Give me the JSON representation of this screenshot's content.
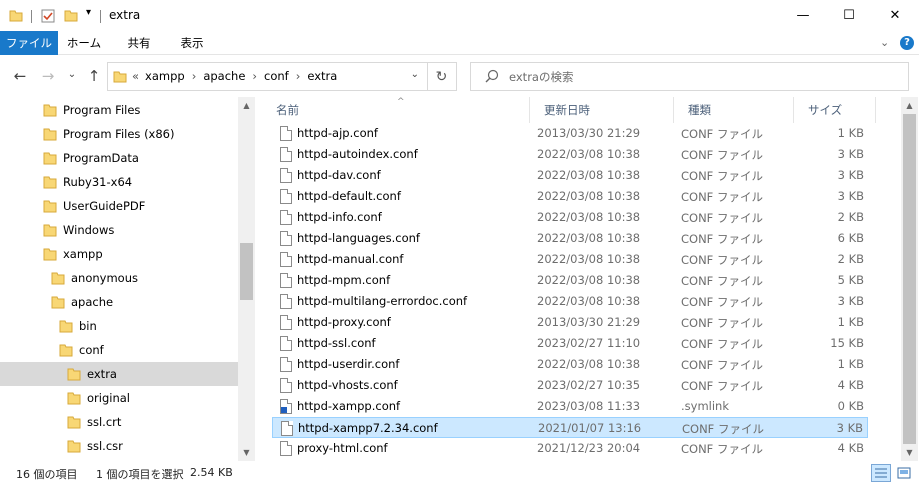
{
  "window": {
    "title": "extra",
    "minimize": "—",
    "maximize": "☐",
    "close": "✕"
  },
  "ribbon": {
    "tabs": [
      "ファイル",
      "ホーム",
      "共有",
      "表示"
    ],
    "help": "?",
    "collapse": "⌄"
  },
  "nav": {
    "back": "←",
    "forward": "→",
    "recent": "⌄",
    "up": "↑",
    "overflow": "«",
    "crumbs": [
      "xampp",
      "apache",
      "conf",
      "extra"
    ],
    "crumb_sep": "›",
    "dropdown": "⌄",
    "refresh": "↻",
    "search_placeholder": "extraの検索"
  },
  "sidebar": {
    "items": [
      {
        "label": "Program Files",
        "indent": 0,
        "icon": "folder-icon"
      },
      {
        "label": "Program Files (x86)",
        "indent": 0,
        "icon": "folder-icon"
      },
      {
        "label": "ProgramData",
        "indent": 0,
        "icon": "folder-icon"
      },
      {
        "label": "Ruby31-x64",
        "indent": 0,
        "icon": "folder-icon"
      },
      {
        "label": "UserGuidePDF",
        "indent": 0,
        "icon": "folder-icon"
      },
      {
        "label": "Windows",
        "indent": 0,
        "icon": "folder-icon"
      },
      {
        "label": "xampp",
        "indent": 0,
        "icon": "folder-icon"
      },
      {
        "label": "anonymous",
        "indent": 1,
        "icon": "folder-icon"
      },
      {
        "label": "apache",
        "indent": 1,
        "icon": "folder-icon"
      },
      {
        "label": "bin",
        "indent": 2,
        "icon": "folder-icon"
      },
      {
        "label": "conf",
        "indent": 2,
        "icon": "folder-icon"
      },
      {
        "label": "extra",
        "indent": 3,
        "icon": "folder-icon",
        "selected": true
      },
      {
        "label": "original",
        "indent": 3,
        "icon": "folder-icon"
      },
      {
        "label": "ssl.crt",
        "indent": 3,
        "icon": "folder-icon"
      },
      {
        "label": "ssl.csr",
        "indent": 3,
        "icon": "folder-icon"
      }
    ]
  },
  "columns": {
    "name": "名前",
    "date": "更新日時",
    "type": "種類",
    "size": "サイズ",
    "sort_arrow": "^"
  },
  "files": [
    {
      "name": "httpd-ajp.conf",
      "date": "2013/03/30 21:29",
      "type": "CONF ファイル",
      "size": "1 KB"
    },
    {
      "name": "httpd-autoindex.conf",
      "date": "2022/03/08 10:38",
      "type": "CONF ファイル",
      "size": "3 KB"
    },
    {
      "name": "httpd-dav.conf",
      "date": "2022/03/08 10:38",
      "type": "CONF ファイル",
      "size": "3 KB"
    },
    {
      "name": "httpd-default.conf",
      "date": "2022/03/08 10:38",
      "type": "CONF ファイル",
      "size": "3 KB"
    },
    {
      "name": "httpd-info.conf",
      "date": "2022/03/08 10:38",
      "type": "CONF ファイル",
      "size": "2 KB"
    },
    {
      "name": "httpd-languages.conf",
      "date": "2022/03/08 10:38",
      "type": "CONF ファイル",
      "size": "6 KB"
    },
    {
      "name": "httpd-manual.conf",
      "date": "2022/03/08 10:38",
      "type": "CONF ファイル",
      "size": "2 KB"
    },
    {
      "name": "httpd-mpm.conf",
      "date": "2022/03/08 10:38",
      "type": "CONF ファイル",
      "size": "5 KB"
    },
    {
      "name": "httpd-multilang-errordoc.conf",
      "date": "2022/03/08 10:38",
      "type": "CONF ファイル",
      "size": "3 KB"
    },
    {
      "name": "httpd-proxy.conf",
      "date": "2013/03/30 21:29",
      "type": "CONF ファイル",
      "size": "1 KB"
    },
    {
      "name": "httpd-ssl.conf",
      "date": "2023/02/27 11:10",
      "type": "CONF ファイル",
      "size": "15 KB"
    },
    {
      "name": "httpd-userdir.conf",
      "date": "2022/03/08 10:38",
      "type": "CONF ファイル",
      "size": "1 KB"
    },
    {
      "name": "httpd-vhosts.conf",
      "date": "2023/02/27 10:35",
      "type": "CONF ファイル",
      "size": "4 KB"
    },
    {
      "name": "httpd-xampp.conf",
      "date": "2023/03/08 11:33",
      "type": ".symlink",
      "size": "0 KB",
      "symlink": true
    },
    {
      "name": "httpd-xampp7.2.34.conf",
      "date": "2021/01/07 13:16",
      "type": "CONF ファイル",
      "size": "3 KB",
      "selected": true
    },
    {
      "name": "proxy-html.conf",
      "date": "2021/12/23 20:04",
      "type": "CONF ファイル",
      "size": "4 KB"
    }
  ],
  "status": {
    "count": "16 個の項目",
    "selection": "1 個の項目を選択",
    "selection_size": "2.54 KB"
  },
  "colors": {
    "accent": "#1979ca",
    "selected_bg": "#cce8ff",
    "folder": "#f8d775"
  }
}
